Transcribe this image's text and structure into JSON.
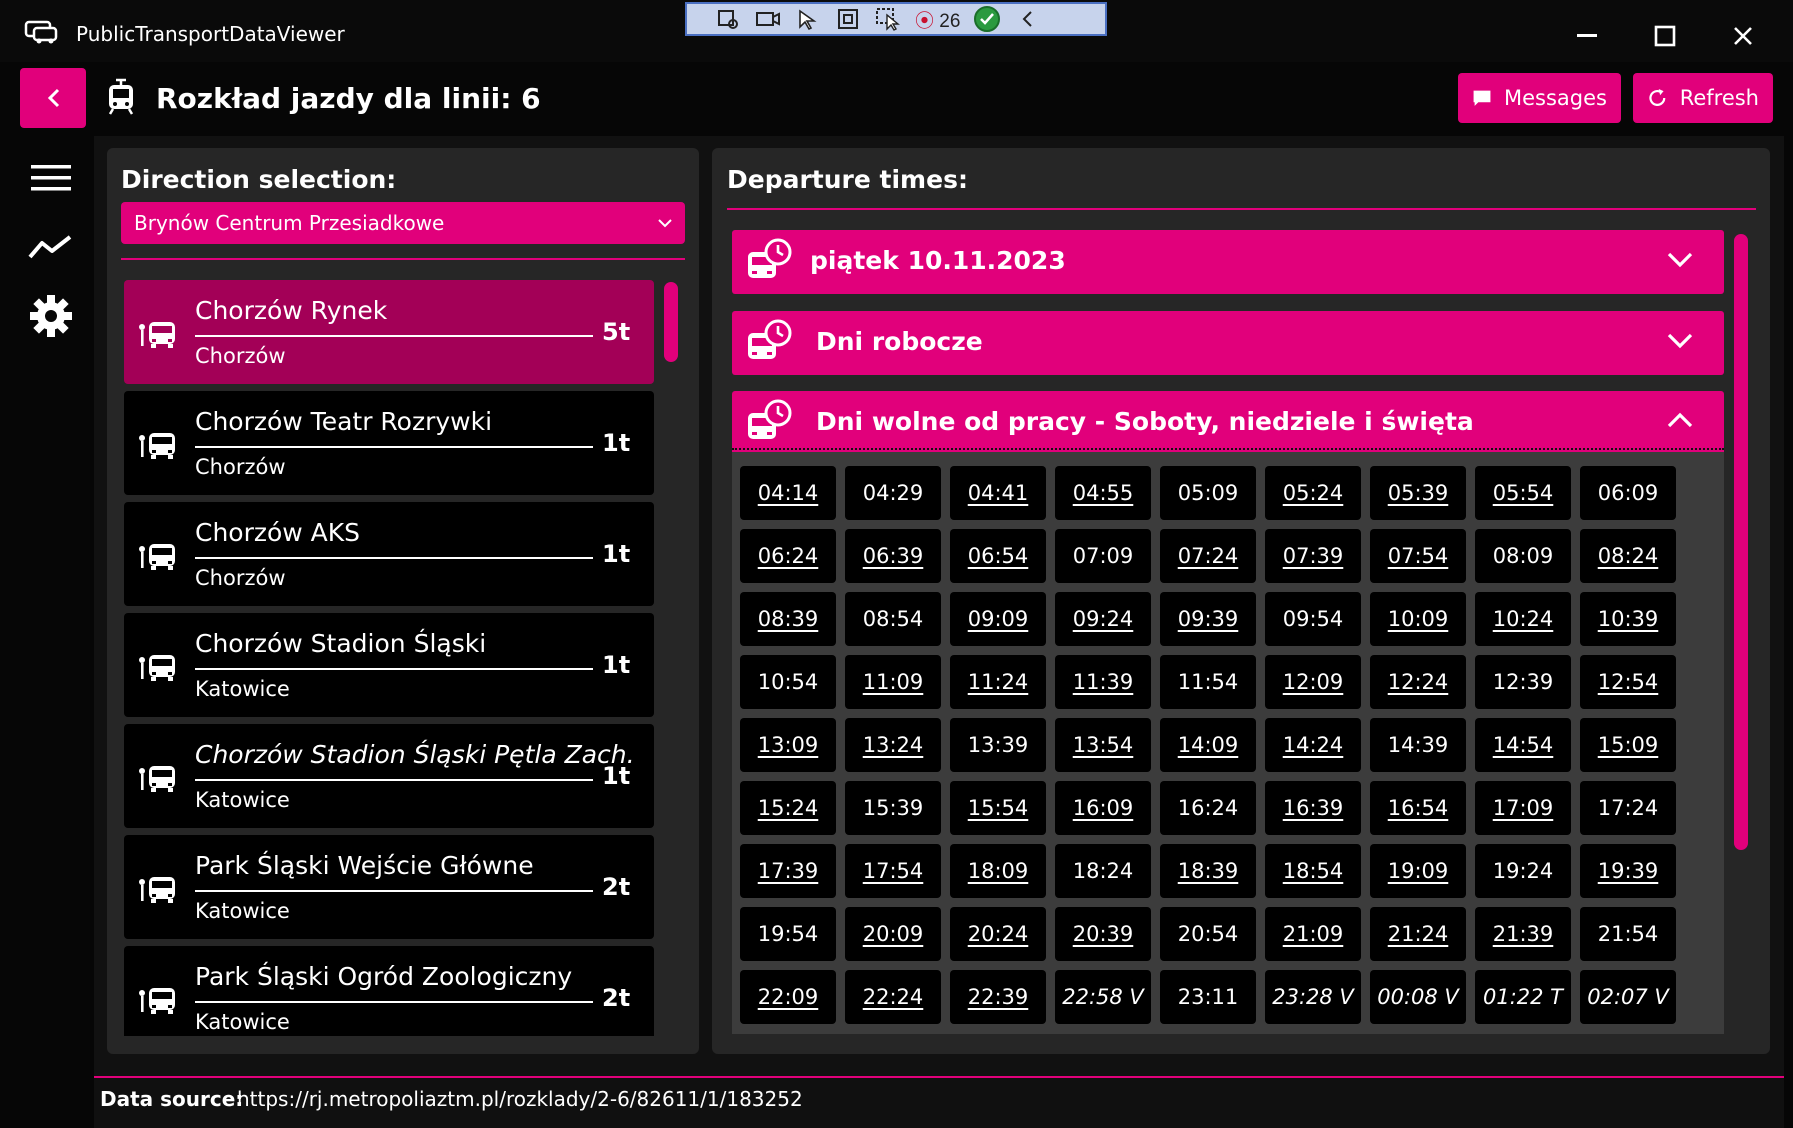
{
  "window": {
    "title": "PublicTransportDataViewer",
    "debug_counter": "26"
  },
  "header": {
    "title": "Rozkład jazdy dla linii: 6",
    "messages_label": "Messages",
    "refresh_label": "Refresh"
  },
  "colors": {
    "accent": "#e1007b",
    "selected": "#a30057",
    "background": "#060606",
    "panel": "#262626"
  },
  "left": {
    "label": "Direction selection:",
    "direction": "Brynów Centrum Przesiadkowe",
    "stops": [
      {
        "name": "Chorzów Rynek",
        "city": "Chorzów",
        "time": "5t",
        "selected": true,
        "italic": false
      },
      {
        "name": "Chorzów Teatr Rozrywki",
        "city": "Chorzów",
        "time": "1t",
        "selected": false,
        "italic": false
      },
      {
        "name": "Chorzów AKS",
        "city": "Chorzów",
        "time": "1t",
        "selected": false,
        "italic": false
      },
      {
        "name": "Chorzów Stadion Śląski",
        "city": "Katowice",
        "time": "1t",
        "selected": false,
        "italic": false
      },
      {
        "name": "Chorzów Stadion Śląski Pętla Zach.",
        "city": "Katowice",
        "time": "1t",
        "selected": false,
        "italic": true
      },
      {
        "name": "Park Śląski Wejście Główne",
        "city": "Katowice",
        "time": "2t",
        "selected": false,
        "italic": false
      },
      {
        "name": "Park Śląski Ogród Zoologiczny",
        "city": "Katowice",
        "time": "2t",
        "selected": false,
        "italic": false
      }
    ]
  },
  "right": {
    "label": "Departure times:",
    "sections": [
      {
        "title": "piątek 10.11.2023",
        "expanded": false
      },
      {
        "title": "Dni robocze",
        "expanded": false
      },
      {
        "title": "Dni wolne od pracy - Soboty, niedziele i święta",
        "expanded": true
      }
    ],
    "times": [
      [
        "04:14",
        "u"
      ],
      [
        "04:29",
        ""
      ],
      [
        "04:41",
        "u"
      ],
      [
        "04:55",
        "u"
      ],
      [
        "05:09",
        ""
      ],
      [
        "05:24",
        "u"
      ],
      [
        "05:39",
        "u"
      ],
      [
        "05:54",
        "u"
      ],
      [
        "06:09",
        ""
      ],
      [
        "06:24",
        "u"
      ],
      [
        "06:39",
        "u"
      ],
      [
        "06:54",
        "u"
      ],
      [
        "07:09",
        ""
      ],
      [
        "07:24",
        "u"
      ],
      [
        "07:39",
        "u"
      ],
      [
        "07:54",
        "u"
      ],
      [
        "08:09",
        ""
      ],
      [
        "08:24",
        "u"
      ],
      [
        "08:39",
        "u"
      ],
      [
        "08:54",
        ""
      ],
      [
        "09:09",
        "u"
      ],
      [
        "09:24",
        "u"
      ],
      [
        "09:39",
        "u"
      ],
      [
        "09:54",
        ""
      ],
      [
        "10:09",
        "u"
      ],
      [
        "10:24",
        "u"
      ],
      [
        "10:39",
        "u"
      ],
      [
        "10:54",
        ""
      ],
      [
        "11:09",
        "u"
      ],
      [
        "11:24",
        "u"
      ],
      [
        "11:39",
        "u"
      ],
      [
        "11:54",
        ""
      ],
      [
        "12:09",
        "u"
      ],
      [
        "12:24",
        "u"
      ],
      [
        "12:39",
        ""
      ],
      [
        "12:54",
        "u"
      ],
      [
        "13:09",
        "u"
      ],
      [
        "13:24",
        "u"
      ],
      [
        "13:39",
        ""
      ],
      [
        "13:54",
        "u"
      ],
      [
        "14:09",
        "u"
      ],
      [
        "14:24",
        "u"
      ],
      [
        "14:39",
        ""
      ],
      [
        "14:54",
        "u"
      ],
      [
        "15:09",
        "u"
      ],
      [
        "15:24",
        "u"
      ],
      [
        "15:39",
        ""
      ],
      [
        "15:54",
        "u"
      ],
      [
        "16:09",
        "u"
      ],
      [
        "16:24",
        ""
      ],
      [
        "16:39",
        "u"
      ],
      [
        "16:54",
        "u"
      ],
      [
        "17:09",
        "u"
      ],
      [
        "17:24",
        ""
      ],
      [
        "17:39",
        "u"
      ],
      [
        "17:54",
        "u"
      ],
      [
        "18:09",
        "u"
      ],
      [
        "18:24",
        ""
      ],
      [
        "18:39",
        "u"
      ],
      [
        "18:54",
        "u"
      ],
      [
        "19:09",
        "u"
      ],
      [
        "19:24",
        ""
      ],
      [
        "19:39",
        "u"
      ],
      [
        "19:54",
        ""
      ],
      [
        "20:09",
        "u"
      ],
      [
        "20:24",
        "u"
      ],
      [
        "20:39",
        "u"
      ],
      [
        "20:54",
        ""
      ],
      [
        "21:09",
        "u"
      ],
      [
        "21:24",
        "u"
      ],
      [
        "21:39",
        "u"
      ],
      [
        "21:54",
        ""
      ],
      [
        "22:09",
        "u"
      ],
      [
        "22:24",
        "u"
      ],
      [
        "22:39",
        "u"
      ],
      [
        "22:58 V",
        "i"
      ],
      [
        "23:11",
        ""
      ],
      [
        "23:28 V",
        "i"
      ],
      [
        "00:08 V",
        "i"
      ],
      [
        "01:22 T",
        "i"
      ],
      [
        "02:07 V",
        "i"
      ]
    ]
  },
  "footer": {
    "label": "Data source:",
    "url": "https://rj.metropoliaztm.pl/rozklady/2-6/82611/1/183252"
  }
}
